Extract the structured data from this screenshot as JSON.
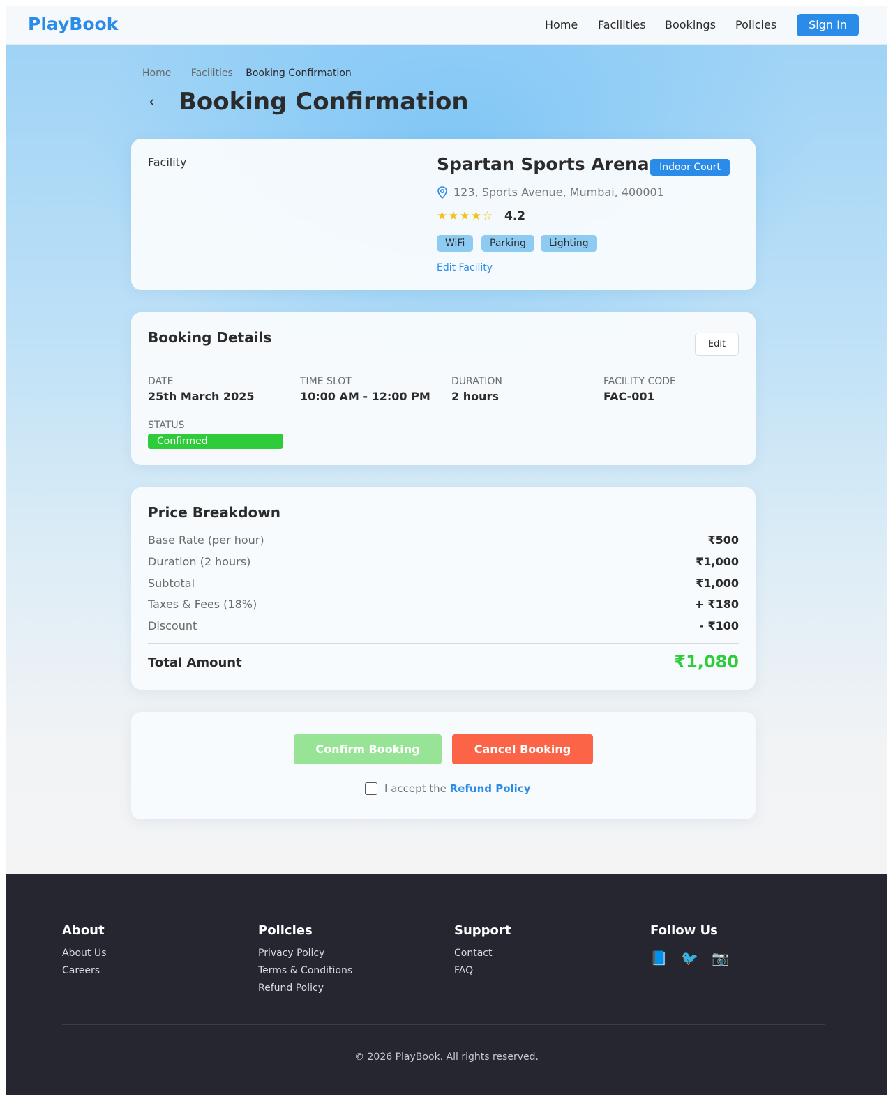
{
  "nav": {
    "brand": "PlayBook",
    "links": [
      "Home",
      "Facilities",
      "Bookings",
      "Policies"
    ],
    "signin": "Sign In"
  },
  "breadcrumb": [
    "Home",
    "Facilities",
    "Booking Confirmation"
  ],
  "page_title": "Booking Confirmation",
  "back_glyph": "‹",
  "facility": {
    "image_alt": "Facility",
    "name": "Spartan Sports Arena",
    "type_badge": "Indoor Court",
    "address": "123, Sports Avenue, Mumbai, 400001",
    "stars": "★★★★☆",
    "rating": "4.2",
    "amenities": [
      "WiFi",
      "Parking",
      "Lighting"
    ],
    "edit_link": "Edit Facility"
  },
  "booking": {
    "title": "Booking Details",
    "edit": "Edit",
    "fields": [
      {
        "label": "DATE",
        "value": "25th March 2025"
      },
      {
        "label": "TIME SLOT",
        "value": "10:00 AM - 12:00 PM"
      },
      {
        "label": "DURATION",
        "value": "2 hours"
      },
      {
        "label": "FACILITY CODE",
        "value": "FAC-001"
      }
    ],
    "status_label": "STATUS",
    "status_value": "Confirmed"
  },
  "price": {
    "title": "Price Breakdown",
    "rows": [
      {
        "label": "Base Rate (per hour)",
        "value": "₹500"
      },
      {
        "label": "Duration (2 hours)",
        "value": "₹1,000"
      },
      {
        "label": "Subtotal",
        "value": "₹1,000"
      },
      {
        "label": "Taxes & Fees (18%)",
        "value": "+ ₹180"
      },
      {
        "label": "Discount",
        "value": "- ₹100"
      }
    ],
    "total_label": "Total Amount",
    "total_value": "₹1,080"
  },
  "actions": {
    "confirm": "Confirm Booking",
    "cancel": "Cancel Booking",
    "accept_text": "I accept the ",
    "accept_link": "Refund Policy"
  },
  "footer": {
    "columns": [
      {
        "heading": "About",
        "links": [
          "About Us",
          "Careers"
        ]
      },
      {
        "heading": "Policies",
        "links": [
          "Privacy Policy",
          "Terms & Conditions",
          "Refund Policy"
        ]
      },
      {
        "heading": "Support",
        "links": [
          "Contact",
          "FAQ"
        ]
      }
    ],
    "follow_heading": "Follow Us",
    "social_icons": [
      "facebook-icon",
      "twitter-icon",
      "instagram-icon"
    ],
    "social_glyphs": [
      "📘",
      "🐦",
      "📷"
    ],
    "copyright": "© 2026 PlayBook. All rights reserved."
  },
  "colors": {
    "accent": "#2a8ce8",
    "success": "#2ecc3a",
    "danger": "#fc6448",
    "footer_bg": "#262630"
  }
}
